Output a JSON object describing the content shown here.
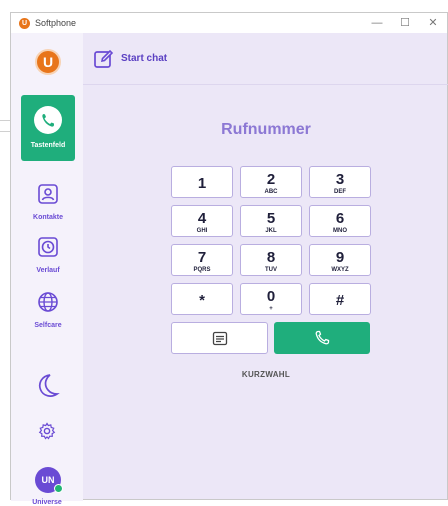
{
  "window": {
    "title": "Softphone",
    "minimize": "—",
    "maximize": "☐",
    "close": "✕"
  },
  "logo": {
    "letter": "U"
  },
  "sidebar": {
    "items": [
      {
        "label": "Tastenfeld",
        "icon": "phone-icon",
        "active": true
      },
      {
        "label": "Kontakte",
        "icon": "contacts-icon"
      },
      {
        "label": "Verlauf",
        "icon": "history-icon"
      },
      {
        "label": "Selfcare",
        "icon": "globe-icon"
      }
    ],
    "theme_icon": "moon-icon",
    "settings_icon": "gear-icon",
    "user": {
      "initials": "UN",
      "name": "Universe",
      "status_color": "#22b573"
    }
  },
  "header": {
    "start_chat": "Start chat",
    "icon": "edit-icon"
  },
  "dialer": {
    "heading": "Rufnummer",
    "keys": [
      {
        "digit": "1",
        "sub": ""
      },
      {
        "digit": "2",
        "sub": "ABC"
      },
      {
        "digit": "3",
        "sub": "DEF"
      },
      {
        "digit": "4",
        "sub": "GHI"
      },
      {
        "digit": "5",
        "sub": "JKL"
      },
      {
        "digit": "6",
        "sub": "MNO"
      },
      {
        "digit": "7",
        "sub": "PQRS"
      },
      {
        "digit": "8",
        "sub": "TUV"
      },
      {
        "digit": "9",
        "sub": "WXYZ"
      },
      {
        "digit": "*",
        "sub": ""
      },
      {
        "digit": "0",
        "sub": "+"
      },
      {
        "digit": "#",
        "sub": ""
      }
    ],
    "message_icon": "message-icon",
    "call_icon": "phone-icon",
    "speed_dial": "KURZWAHL"
  },
  "colors": {
    "accent": "#6a4bd4",
    "call_green": "#1fae7c",
    "brand_orange": "#e8751a",
    "background": "#ece7f7"
  }
}
